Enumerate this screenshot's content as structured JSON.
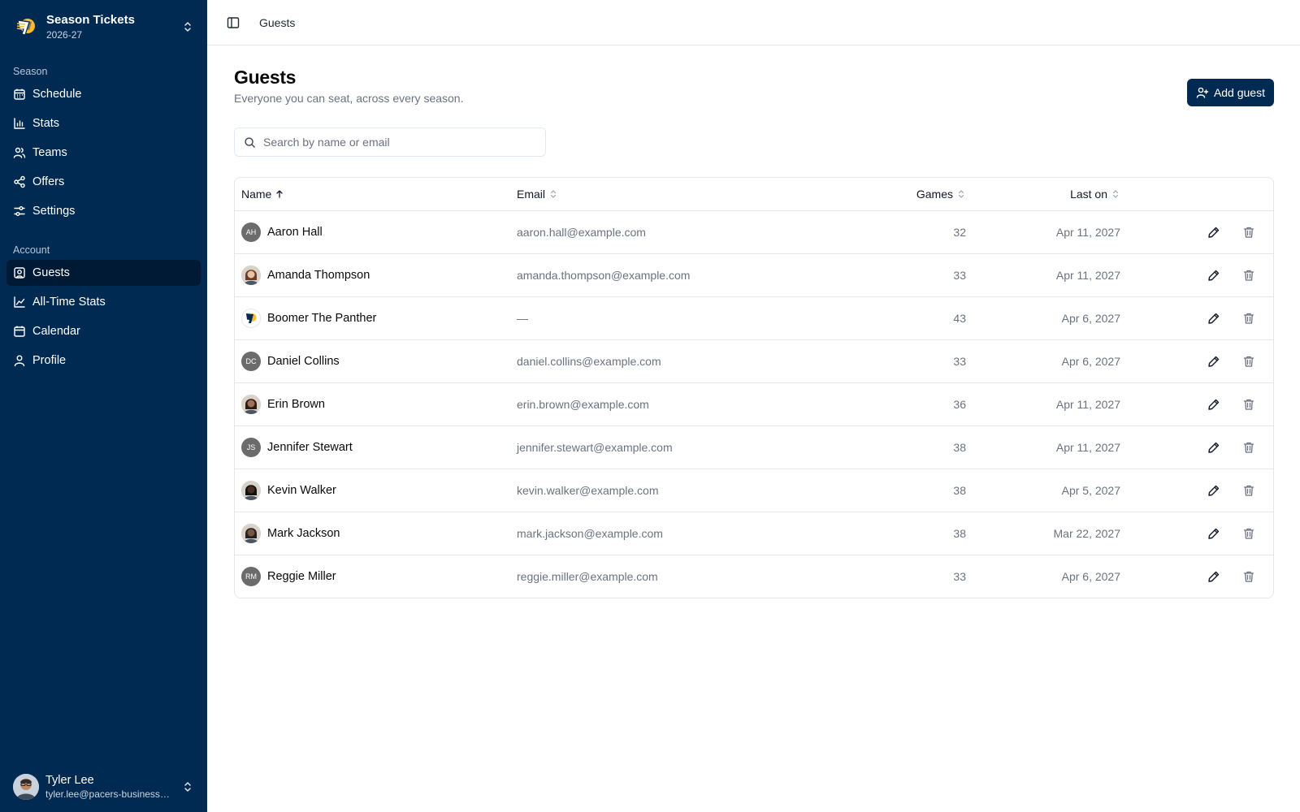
{
  "team": {
    "title": "Season Tickets",
    "season": "2026-27"
  },
  "nav": {
    "season_label": "Season",
    "season_items": [
      {
        "label": "Schedule",
        "icon": "calendar-grid-icon"
      },
      {
        "label": "Stats",
        "icon": "bar-chart-icon"
      },
      {
        "label": "Teams",
        "icon": "users-icon"
      },
      {
        "label": "Offers",
        "icon": "share-icon"
      },
      {
        "label": "Settings",
        "icon": "sliders-icon"
      }
    ],
    "account_label": "Account",
    "account_items": [
      {
        "label": "Guests",
        "icon": "contact-square-icon",
        "active": true
      },
      {
        "label": "All-Time Stats",
        "icon": "line-chart-icon"
      },
      {
        "label": "Calendar",
        "icon": "calendar-icon"
      },
      {
        "label": "Profile",
        "icon": "user-icon"
      }
    ]
  },
  "user": {
    "name": "Tyler Lee",
    "email": "tyler.lee@pacers-business.com"
  },
  "topbar": {
    "breadcrumb": "Guests"
  },
  "page": {
    "title": "Guests",
    "subtitle": "Everyone you can seat, across every season.",
    "add_label": "Add guest"
  },
  "search": {
    "placeholder": "Search by name or email",
    "value": ""
  },
  "table": {
    "columns": {
      "name": "Name",
      "email": "Email",
      "games": "Games",
      "last_on": "Last on"
    },
    "rows": [
      {
        "initials": "AH",
        "avatar": "initials",
        "name": "Aaron Hall",
        "email": "aaron.hall@example.com",
        "games": "32",
        "last_on": "Apr 11, 2027"
      },
      {
        "initials": "",
        "avatar": "photo",
        "name": "Amanda Thompson",
        "email": "amanda.thompson@example.com",
        "games": "33",
        "last_on": "Apr 11, 2027"
      },
      {
        "initials": "",
        "avatar": "logo",
        "name": "Boomer The Panther",
        "email": "—",
        "games": "43",
        "last_on": "Apr 6, 2027"
      },
      {
        "initials": "DC",
        "avatar": "initials",
        "name": "Daniel Collins",
        "email": "daniel.collins@example.com",
        "games": "33",
        "last_on": "Apr 6, 2027"
      },
      {
        "initials": "",
        "avatar": "photo",
        "name": "Erin Brown",
        "email": "erin.brown@example.com",
        "games": "36",
        "last_on": "Apr 11, 2027"
      },
      {
        "initials": "JS",
        "avatar": "initials",
        "name": "Jennifer Stewart",
        "email": "jennifer.stewart@example.com",
        "games": "38",
        "last_on": "Apr 11, 2027"
      },
      {
        "initials": "",
        "avatar": "photo",
        "name": "Kevin Walker",
        "email": "kevin.walker@example.com",
        "games": "38",
        "last_on": "Apr 5, 2027"
      },
      {
        "initials": "",
        "avatar": "photo",
        "name": "Mark Jackson",
        "email": "mark.jackson@example.com",
        "games": "38",
        "last_on": "Mar 22, 2027"
      },
      {
        "initials": "RM",
        "avatar": "initials",
        "name": "Reggie Miller",
        "email": "reggie.miller@example.com",
        "games": "33",
        "last_on": "Apr 6, 2027"
      }
    ]
  },
  "colors": {
    "sidebar": "#002a52",
    "sidebar_active": "#001a36",
    "accent": "#002a52",
    "gold": "#fdbb30"
  }
}
